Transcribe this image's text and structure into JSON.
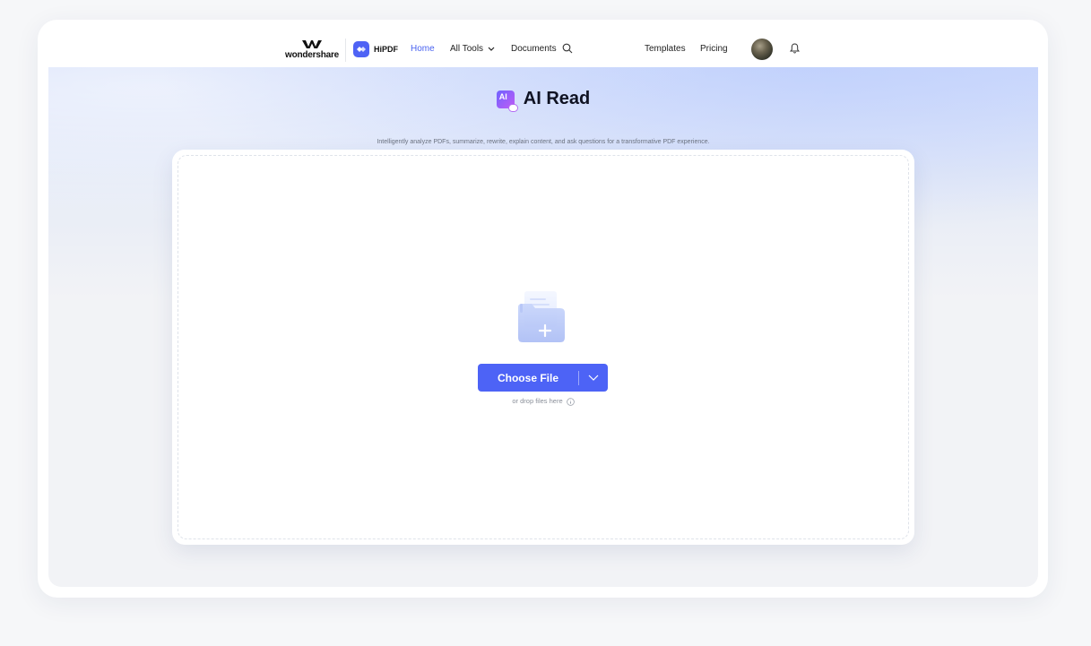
{
  "brand": {
    "name": "wondershare"
  },
  "product": {
    "name": "HiPDF"
  },
  "nav": {
    "home": "Home",
    "all_tools": "All Tools",
    "documents": "Documents",
    "templates": "Templates",
    "pricing": "Pricing"
  },
  "hero": {
    "title": "AI Read",
    "subtitle": "Intelligently analyze PDFs, summarize, rewrite, explain content, and ask questions for a transformative PDF experience."
  },
  "ai_badge": "AI",
  "upload": {
    "button_label": "Choose File",
    "drop_hint": "or drop files here"
  },
  "colors": {
    "accent": "#4d63f6",
    "active_link": "#4a63f0",
    "hero_bg_top": "#d2ddfa"
  },
  "icons": [
    "wondershare-logo-icon",
    "hipdf-logo-icon",
    "chevron-down-icon",
    "search-icon",
    "bell-icon",
    "ai-read-icon",
    "folder-add-icon",
    "info-icon"
  ]
}
